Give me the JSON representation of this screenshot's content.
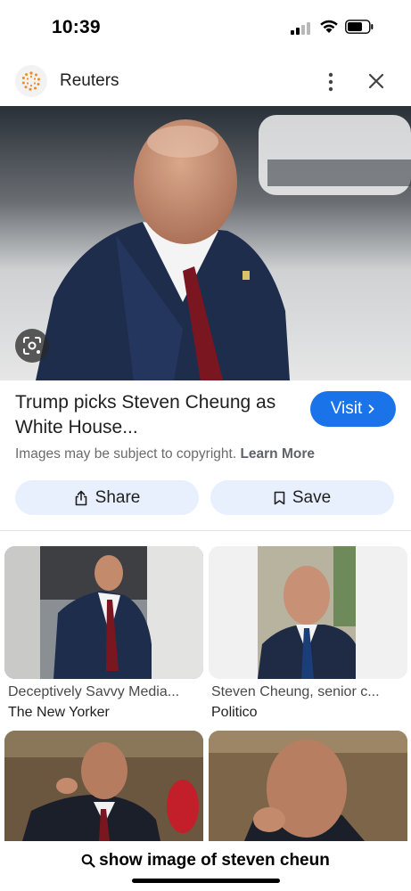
{
  "status_bar": {
    "time": "10:39"
  },
  "source": {
    "name": "Reuters"
  },
  "result": {
    "title": "Trump picks Steven Cheung as White House...",
    "visit_label": "Visit",
    "copyright_text": "Images may be subject to copyright.",
    "learn_more": "Learn More",
    "share_label": "Share",
    "save_label": "Save"
  },
  "related": [
    {
      "title": "Deceptively Savvy Media...",
      "source": "The New Yorker"
    },
    {
      "title": "Steven Cheung, senior c...",
      "source": "Politico"
    }
  ],
  "search": {
    "query": "show image of steven cheun"
  },
  "colors": {
    "accent": "#1a73e8",
    "chip_bg": "#e8f0fe"
  }
}
